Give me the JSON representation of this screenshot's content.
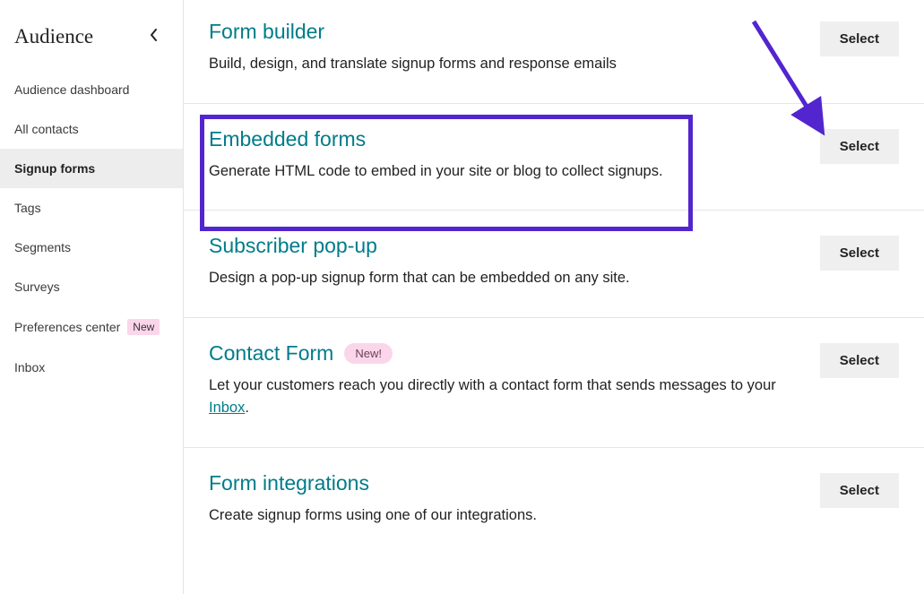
{
  "sidebar": {
    "title": "Audience",
    "items": [
      {
        "label": "Audience dashboard"
      },
      {
        "label": "All contacts"
      },
      {
        "label": "Signup forms"
      },
      {
        "label": "Tags"
      },
      {
        "label": "Segments"
      },
      {
        "label": "Surveys"
      },
      {
        "label": "Preferences center",
        "badge": "New"
      },
      {
        "label": "Inbox"
      }
    ]
  },
  "forms": {
    "form_builder": {
      "title": "Form builder",
      "desc": "Build, design, and translate signup forms and response emails",
      "button": "Select"
    },
    "embedded": {
      "title": "Embedded forms",
      "desc": "Generate HTML code to embed in your site or blog to collect signups.",
      "button": "Select"
    },
    "popup": {
      "title": "Subscriber pop-up",
      "desc": "Design a pop-up signup form that can be embedded on any site.",
      "button": "Select"
    },
    "contact": {
      "title": "Contact Form",
      "badge": "New!",
      "desc_pre": "Let your customers reach you directly with a contact form that sends messages to your ",
      "desc_link": "Inbox",
      "desc_post": ".",
      "button": "Select"
    },
    "integrations": {
      "title": "Form integrations",
      "desc": "Create signup forms using one of our integrations.",
      "button": "Select"
    }
  }
}
